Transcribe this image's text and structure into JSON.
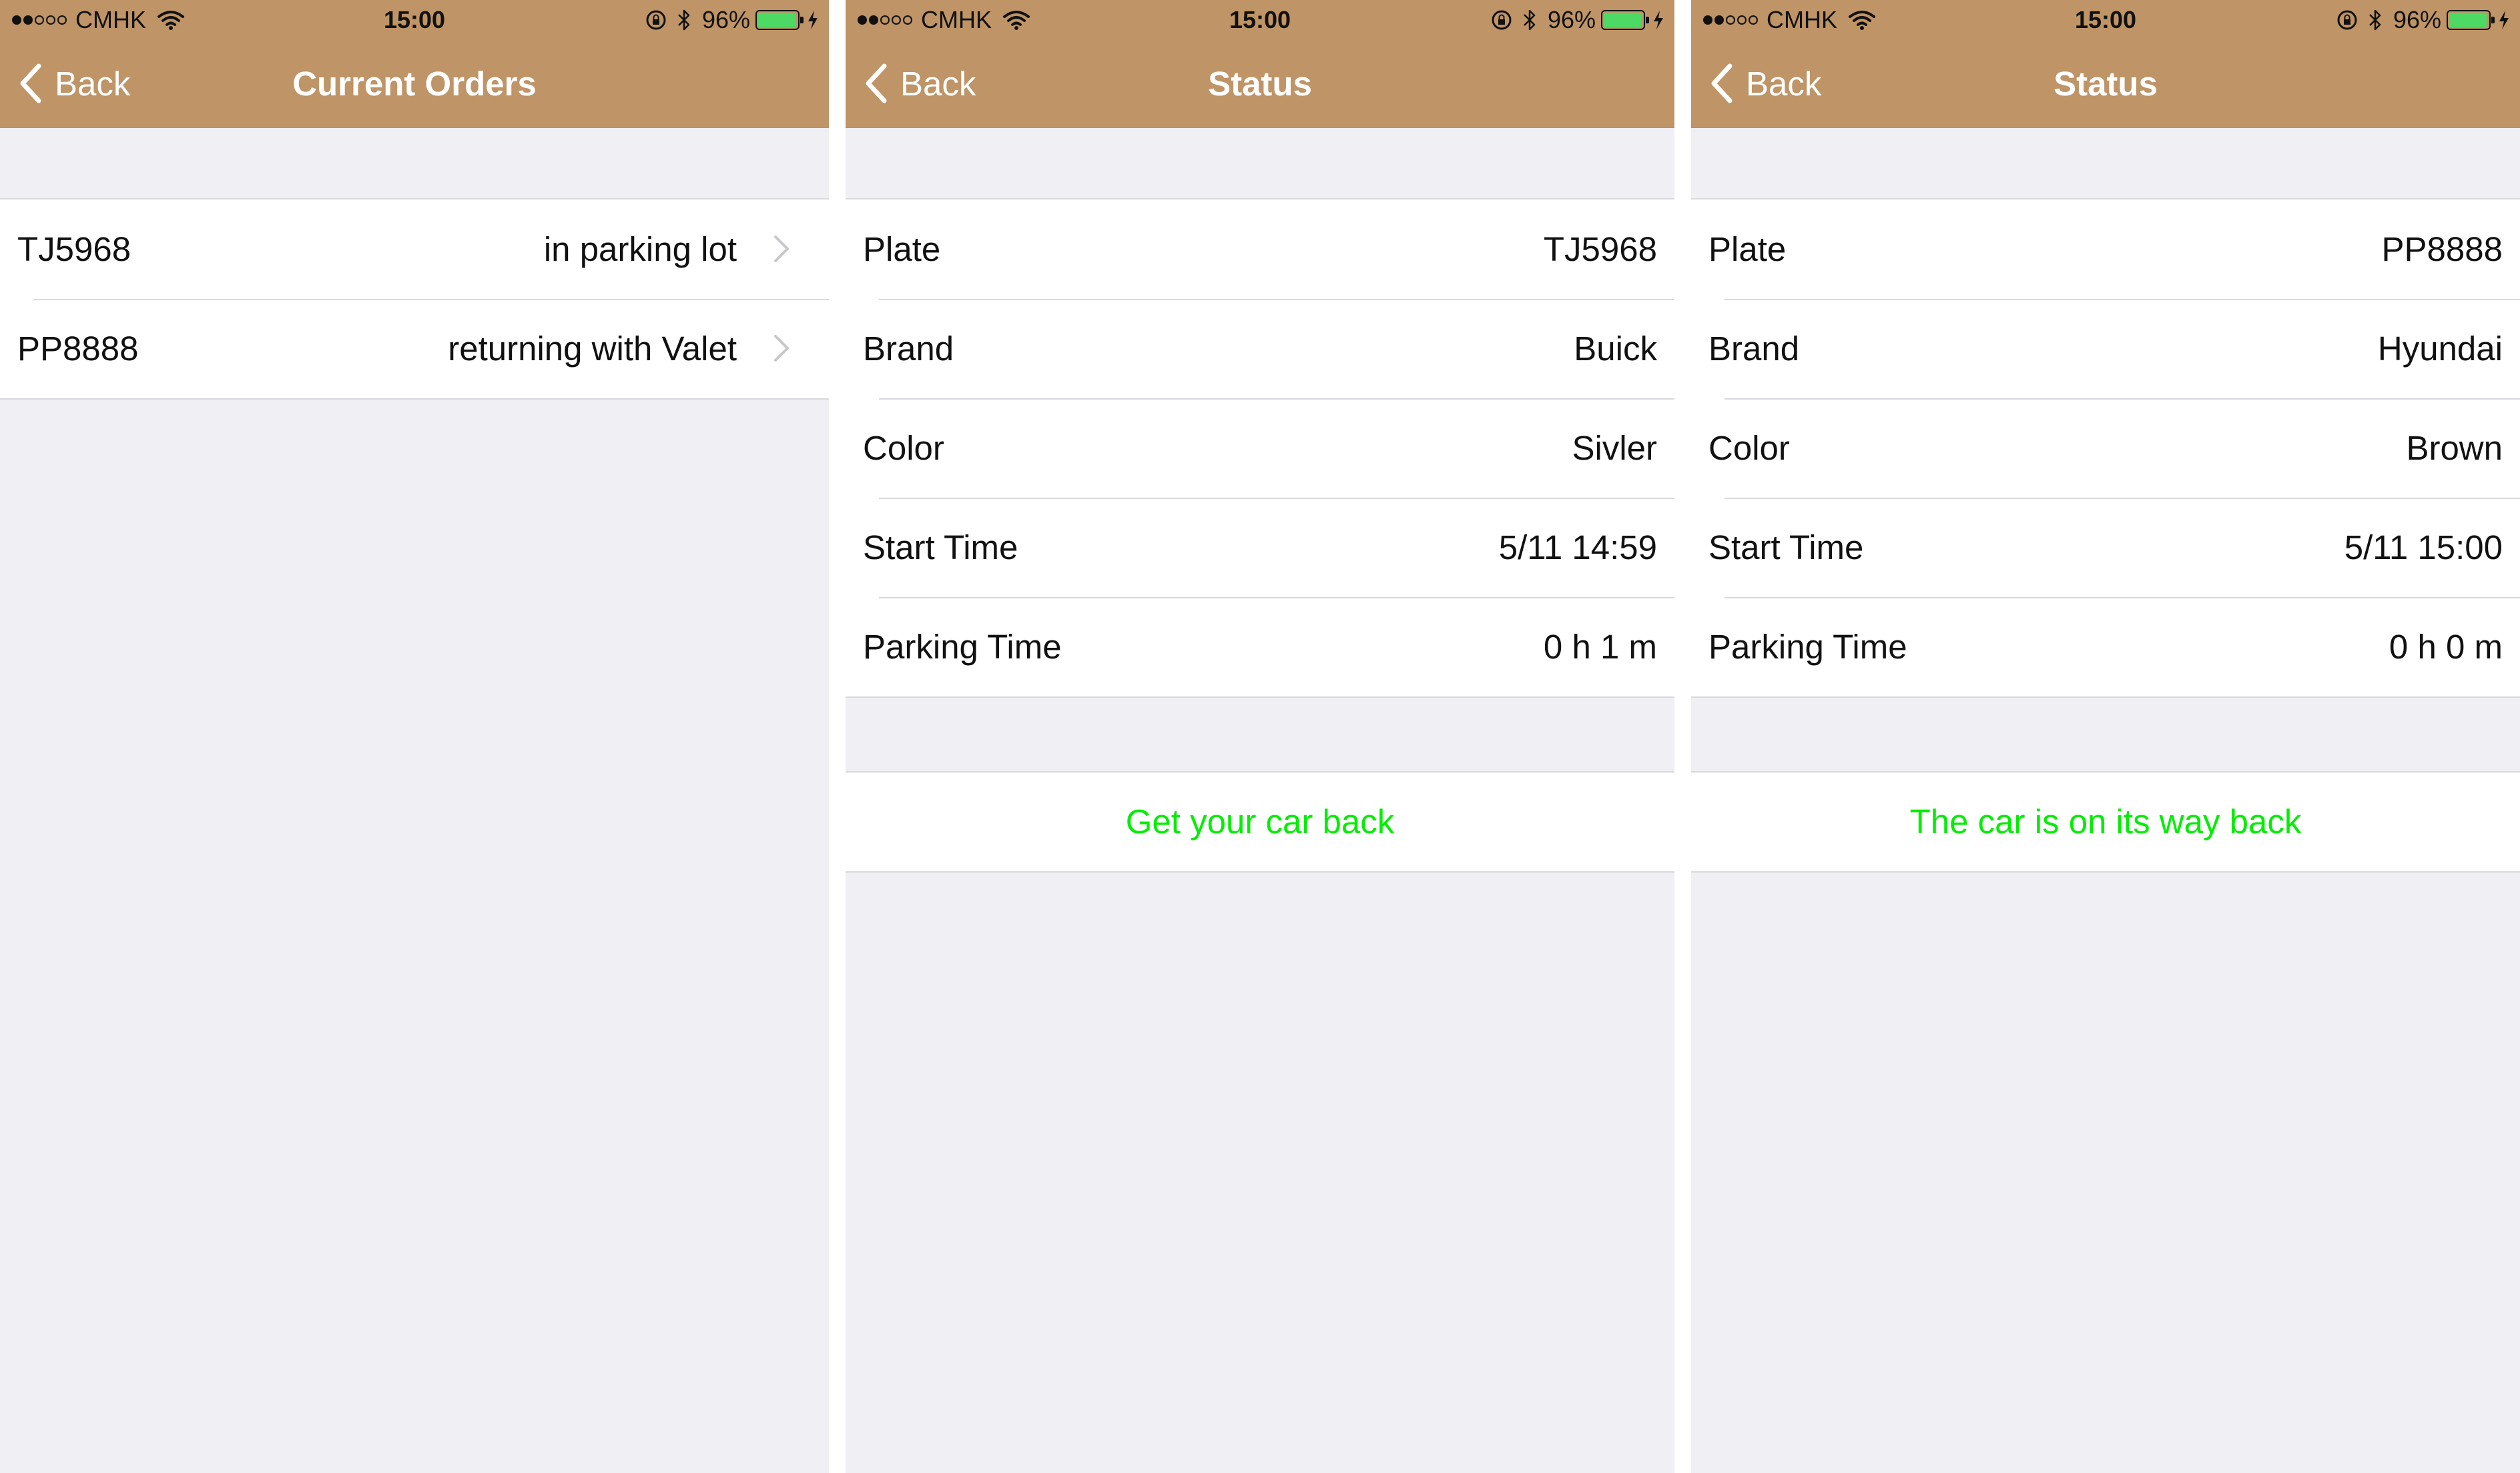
{
  "status_bar": {
    "carrier": "CMHK",
    "time": "15:00",
    "battery_percent": "96%",
    "battery_level": 0.96,
    "battery_color": "#4cd964"
  },
  "colors": {
    "nav_bar": "#bf9466",
    "action_text": "#00ee00",
    "background": "#efeff4"
  },
  "screens": [
    {
      "back_label": "Back",
      "title": "Current Orders",
      "orders": [
        {
          "plate": "TJ5968",
          "status": "in parking lot"
        },
        {
          "plate": "PP8888",
          "status": "returning with Valet"
        }
      ]
    },
    {
      "back_label": "Back",
      "title": "Status",
      "rows": [
        {
          "label": "Plate",
          "value": "TJ5968"
        },
        {
          "label": "Brand",
          "value": "Buick"
        },
        {
          "label": "Color",
          "value": "Sivler"
        },
        {
          "label": "Start Time",
          "value": "5/11 14:59"
        },
        {
          "label": "Parking Time",
          "value": "0 h 1 m"
        }
      ],
      "action": "Get your car back"
    },
    {
      "back_label": "Back",
      "title": "Status",
      "rows": [
        {
          "label": "Plate",
          "value": "PP8888"
        },
        {
          "label": "Brand",
          "value": "Hyundai"
        },
        {
          "label": "Color",
          "value": "Brown"
        },
        {
          "label": "Start Time",
          "value": "5/11 15:00"
        },
        {
          "label": "Parking Time",
          "value": "0 h 0 m"
        }
      ],
      "action": "The car is on its way back"
    }
  ]
}
